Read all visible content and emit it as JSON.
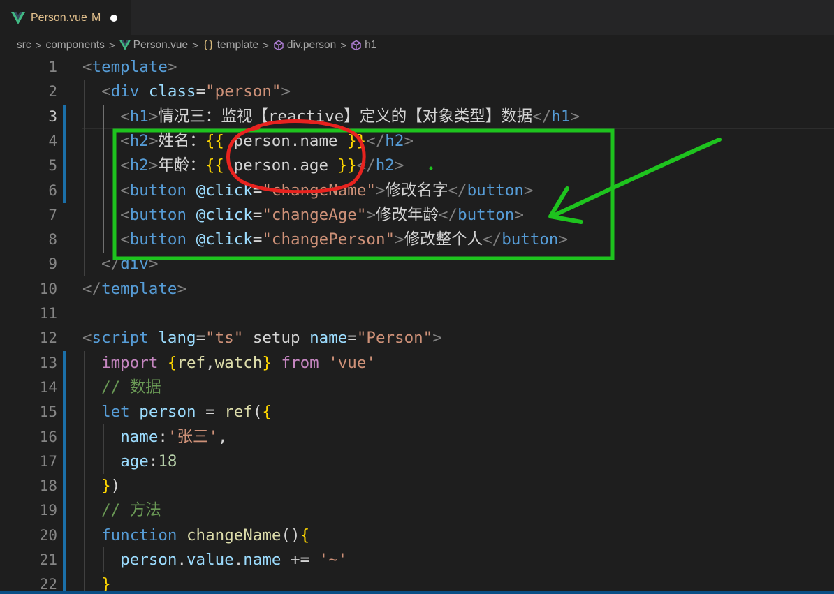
{
  "tab": {
    "filename": "Person.vue",
    "modified_flag": "M",
    "accent_color": "#e2c08d"
  },
  "breadcrumb": {
    "items": [
      "src",
      "components",
      "Person.vue",
      "template",
      "div.person",
      "h1"
    ],
    "separator": ">"
  },
  "editor": {
    "language": "vue",
    "active_line": 3,
    "lines": [
      {
        "n": "1",
        "code": "<template>"
      },
      {
        "n": "2",
        "code": "  <div class=\"person\">"
      },
      {
        "n": "3",
        "code": "    <h1>情况三：监视【reactive】定义的【对象类型】数据</h1>"
      },
      {
        "n": "4",
        "code": "    <h2>姓名：{{ person.name }}</h2>"
      },
      {
        "n": "5",
        "code": "    <h2>年龄：{{ person.age }}</h2>"
      },
      {
        "n": "6",
        "code": "    <button @click=\"changeName\">修改名字</button>"
      },
      {
        "n": "7",
        "code": "    <button @click=\"changeAge\">修改年龄</button>"
      },
      {
        "n": "8",
        "code": "    <button @click=\"changePerson\">修改整个人</button>"
      },
      {
        "n": "9",
        "code": "  </div>"
      },
      {
        "n": "10",
        "code": "</template>"
      },
      {
        "n": "11",
        "code": ""
      },
      {
        "n": "12",
        "code": "<script lang=\"ts\" setup name=\"Person\">"
      },
      {
        "n": "13",
        "code": "  import {ref,watch} from 'vue'"
      },
      {
        "n": "14",
        "code": "  // 数据"
      },
      {
        "n": "15",
        "code": "  let person = ref({"
      },
      {
        "n": "16",
        "code": "    name:'张三',"
      },
      {
        "n": "17",
        "code": "    age:18"
      },
      {
        "n": "18",
        "code": "  })"
      },
      {
        "n": "19",
        "code": "  // 方法"
      },
      {
        "n": "20",
        "code": "  function changeName(){"
      },
      {
        "n": "21",
        "code": "    person.value.name += '~'"
      },
      {
        "n": "22",
        "code": "  }"
      }
    ]
  },
  "annotations": {
    "highlight_box_color": "#1ec31e",
    "circle_color": "#e8231f",
    "arrow_color": "#1ec31e"
  },
  "icons": [
    "vue-icon",
    "cube-icon",
    "braces-icon",
    "chevron-right-icon"
  ]
}
